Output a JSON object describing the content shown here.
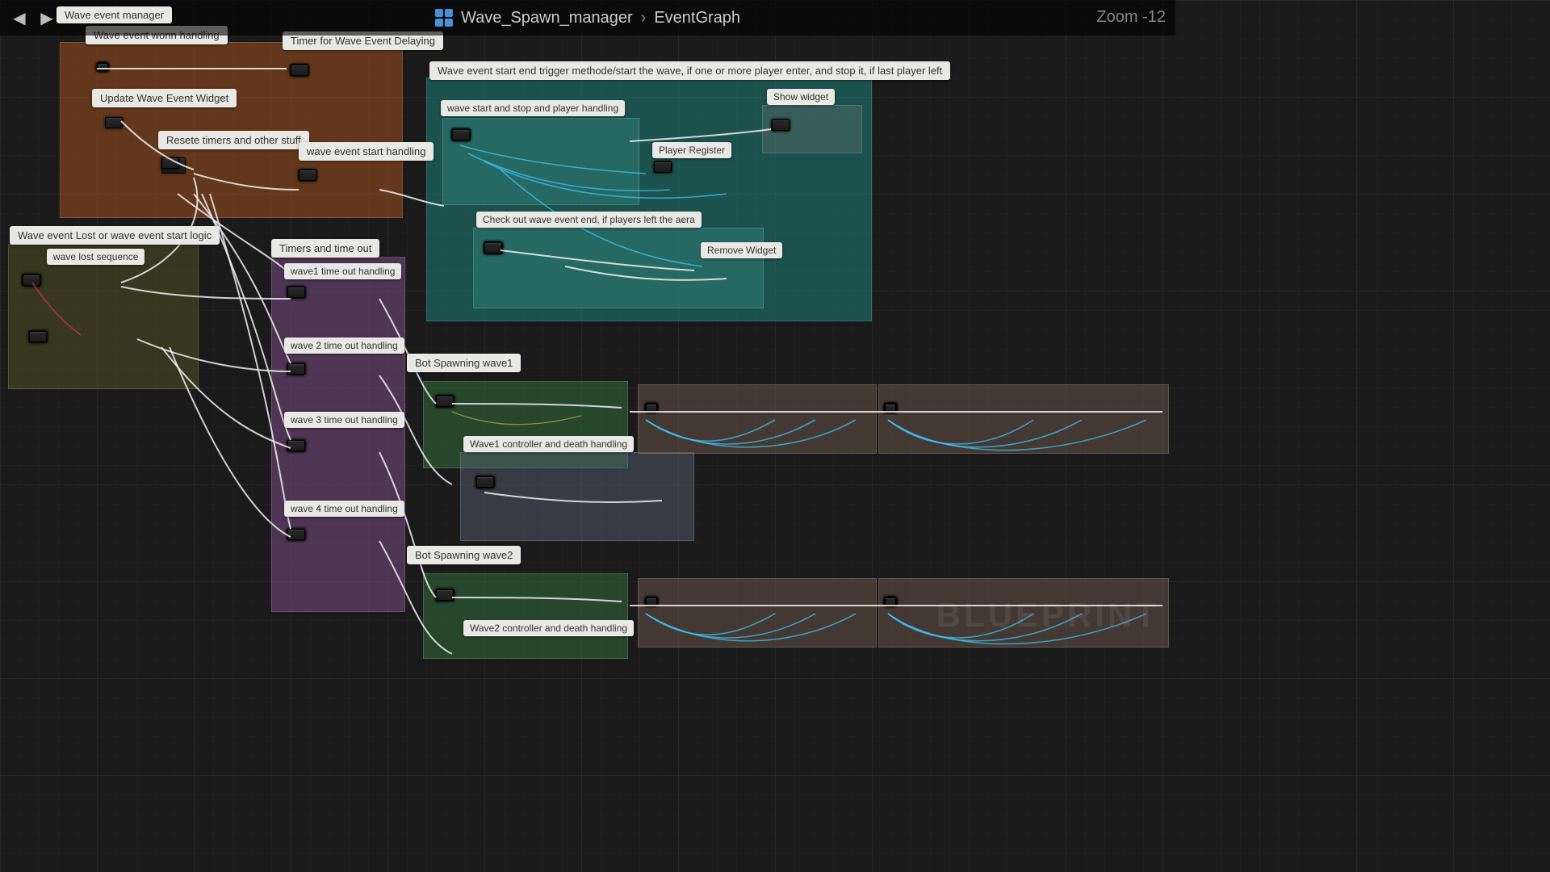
{
  "topbar": {
    "blueprint_name": "Wave_Spawn_manager",
    "graph_name": "EventGraph",
    "zoom_label": "Zoom -12"
  },
  "tab": {
    "title": "Wave event manager"
  },
  "watermark": "BLUEPRINT",
  "comments": {
    "wave_event_wonn": "Wave event wonn handling",
    "timer_delaying": "Timer for Wave Event Delaying",
    "update_widget": "Update Wave Event Widget",
    "reset_timers": "Resete timers and other stuff",
    "wave_event_start": "wave event start handling",
    "lost_or_start": "Wave event Lost or wave event start logic",
    "wave_lost_seq": "wave lost sequence",
    "timers_timeout": "Timers and time out",
    "wave1_timeout": "wave1 time out handling",
    "wave2_timeout": "wave 2 time out handling",
    "wave3_timeout": "wave 3 time out handling",
    "wave4_timeout": "wave 4 time out handling",
    "trigger_method": "Wave event start end trigger methode/start the wave, if one or more player enter, and stop it, if last player left",
    "wave_start_stop": "wave start and stop and player handling",
    "show_widget": "Show widget",
    "player_register": "Player Register",
    "check_end": "Check out wave event end, if players left the aera",
    "remove_widget": "Remove Widget",
    "bot_spawn1": "Bot Spawning wave1",
    "wave1_controller": "Wave1 controller and death handling",
    "bot_spawn2": "Bot Spawning wave2",
    "wave2_controller": "Wave2 controller and death handling"
  }
}
